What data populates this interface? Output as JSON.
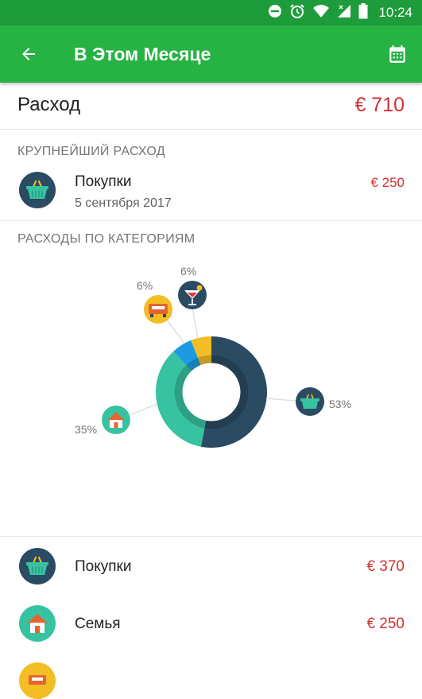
{
  "status_bar": {
    "time": "10:24"
  },
  "app_bar": {
    "title": "В Этом Месяце"
  },
  "summary": {
    "label": "Расход",
    "amount": "€ 710"
  },
  "largest_expense": {
    "header": "КРУПНЕЙШИЙ РАСХОД",
    "name": "Покупки",
    "date": "5 сентября 2017",
    "amount": "€ 250",
    "icon": "basket-icon"
  },
  "categories_chart": {
    "header": "РАСХОДЫ ПО КАТЕГОРИЯМ",
    "labels": {
      "shopping": "53%",
      "family": "35%",
      "transport": "6%",
      "entertainment": "6%"
    }
  },
  "chart_data": {
    "type": "pie",
    "slices": [
      {
        "category": "shopping",
        "value": 53,
        "color": "#2b4b63",
        "icon": "basket-icon"
      },
      {
        "category": "family",
        "value": 35,
        "color": "#37c3a1",
        "icon": "house-icon"
      },
      {
        "category": "entertainment",
        "value": 6,
        "color": "#1e9be0",
        "icon": "cocktail-icon"
      },
      {
        "category": "transport",
        "value": 6,
        "color": "#f3bd25",
        "icon": "car-icon"
      }
    ],
    "inner_ratio": 0.52
  },
  "category_list": [
    {
      "name": "Покупки",
      "amount": "€ 370",
      "icon": "basket-icon"
    },
    {
      "name": "Семья",
      "amount": "€ 250",
      "icon": "house-icon"
    }
  ],
  "colors": {
    "status_bar": "#1e9b3a",
    "app_bar": "#27b244",
    "expense_red": "#d32f2f"
  }
}
